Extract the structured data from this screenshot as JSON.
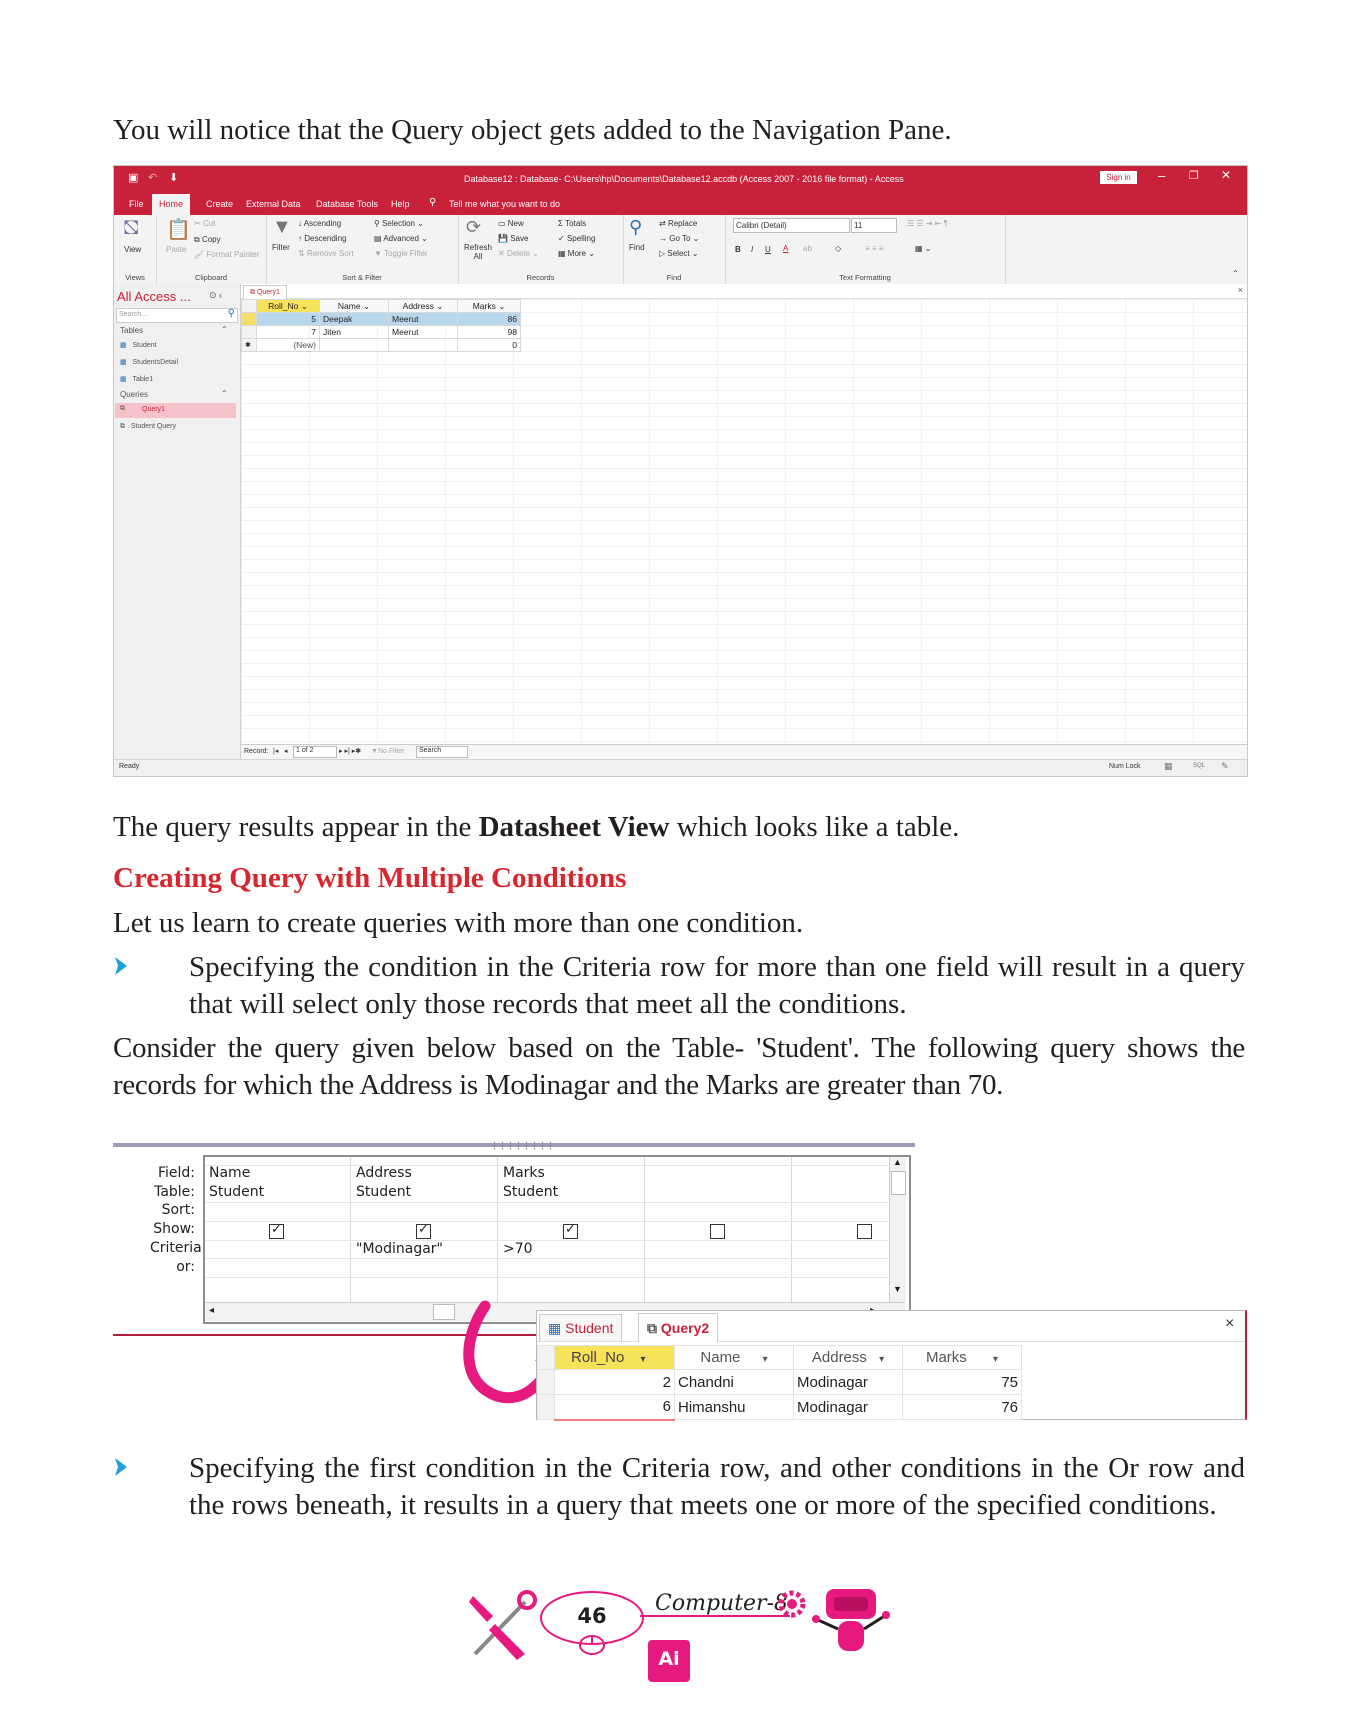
{
  "intro_text": "You will notice that the Query object gets added to the Navigation Pane.",
  "access": {
    "title": "Database12 : Database- C:\\Users\\hp\\Documents\\Database12.accdb (Access 2007 - 2016 file format) - Access",
    "sign_in": "Sign in",
    "menu_tabs": [
      "File",
      "Home",
      "Create",
      "External Data",
      "Database Tools",
      "Help"
    ],
    "tell_me": "Tell me what you want to do",
    "ribbon": {
      "view": "View",
      "paste": "Paste",
      "cut": "Cut",
      "copy": "Copy",
      "format_painter": "Format Painter",
      "filter": "Filter",
      "ascending": "Ascending",
      "descending": "Descending",
      "remove_sort": "Remove Sort",
      "selection": "Selection",
      "advanced": "Advanced",
      "toggle_filter": "Toggle Filter",
      "refresh_all": "Refresh All",
      "new": "New",
      "save": "Save",
      "delete": "Delete",
      "totals": "Totals",
      "spelling": "Spelling",
      "more": "More",
      "find": "Find",
      "replace": "Replace",
      "go_to": "Go To",
      "select": "Select",
      "font": "Calibri (Detail)",
      "font_size": "11",
      "groups": [
        "Views",
        "Clipboard",
        "Sort & Filter",
        "Records",
        "Find",
        "Text Formatting"
      ]
    },
    "nav": {
      "header": "All Access ...",
      "search_placeholder": "Search...",
      "tables_label": "Tables",
      "tables": [
        "Student",
        "StudentsDetail",
        "Table1"
      ],
      "queries_label": "Queries",
      "queries": [
        "Query1",
        "Student Query"
      ]
    },
    "doc_tab": "Query1",
    "columns": [
      "Roll_No",
      "Name",
      "Address",
      "Marks"
    ],
    "rows": [
      {
        "roll": "5",
        "name": "Deepak",
        "address": "Meerut",
        "marks": "86"
      },
      {
        "roll": "7",
        "name": "Jiten",
        "address": "Meerut",
        "marks": "98"
      }
    ],
    "new_row_label": "(New)",
    "new_row_marks": "0",
    "record_label": "Record:",
    "record_pos": "1 of 2",
    "no_filter": "No Filter",
    "search_label": "Search",
    "status_ready": "Ready",
    "status_numlock": "Num Lock",
    "colors": {
      "title": "#c8213a",
      "selected_row": "#b8d7ec",
      "nav_selected": "#f5c2c9",
      "header_cell": "#f7e25b"
    }
  },
  "datasheet_text": {
    "pre": "The query results appear in the ",
    "bold": "Datasheet View",
    "post": " which looks like a table."
  },
  "heading": "Creating Query with Multiple Conditions",
  "learn_text": "Let us learn to create queries with more than one condition.",
  "bullet1": "Specifying the condition in the Criteria row for more than one field will result in a query that will select only those records that meet all the conditions.",
  "consider_text": "Consider the query given below based on the Table- 'Student'. The following query shows the records for which the Address is Modinagar and the Marks are greater than 70.",
  "design": {
    "row_labels": [
      "Field:",
      "Table:",
      "Sort:",
      "Show:",
      "Criteria:",
      "or:"
    ],
    "fields": [
      "Name",
      "Address",
      "Marks",
      "",
      ""
    ],
    "tables": [
      "Student",
      "Student",
      "Student",
      "",
      ""
    ],
    "show": [
      true,
      true,
      true,
      false,
      false
    ],
    "criteria": [
      "",
      "\"Modinagar\"",
      ">70",
      "",
      ""
    ]
  },
  "query2": {
    "tabs": [
      "Student",
      "Query2"
    ],
    "close": "×",
    "columns": [
      "Roll_No",
      "Name",
      "Address",
      "Marks"
    ],
    "rows": [
      {
        "roll": "2",
        "name": "Chandni",
        "address": "Modinagar",
        "marks": "75"
      },
      {
        "roll": "6",
        "name": "Himanshu",
        "address": "Modinagar",
        "marks": "76"
      }
    ]
  },
  "bullet2": "Specifying the first condition in the Criteria row, and other conditions in the Or row and the rows beneath, it results in a query that meets one or more of the specified conditions.",
  "footer": {
    "page_number": "46",
    "book_title": "Computer-8",
    "ai_badge": "Ai",
    "colors": {
      "accent": "#e6197f",
      "bullet": "#1fa0dd"
    }
  }
}
